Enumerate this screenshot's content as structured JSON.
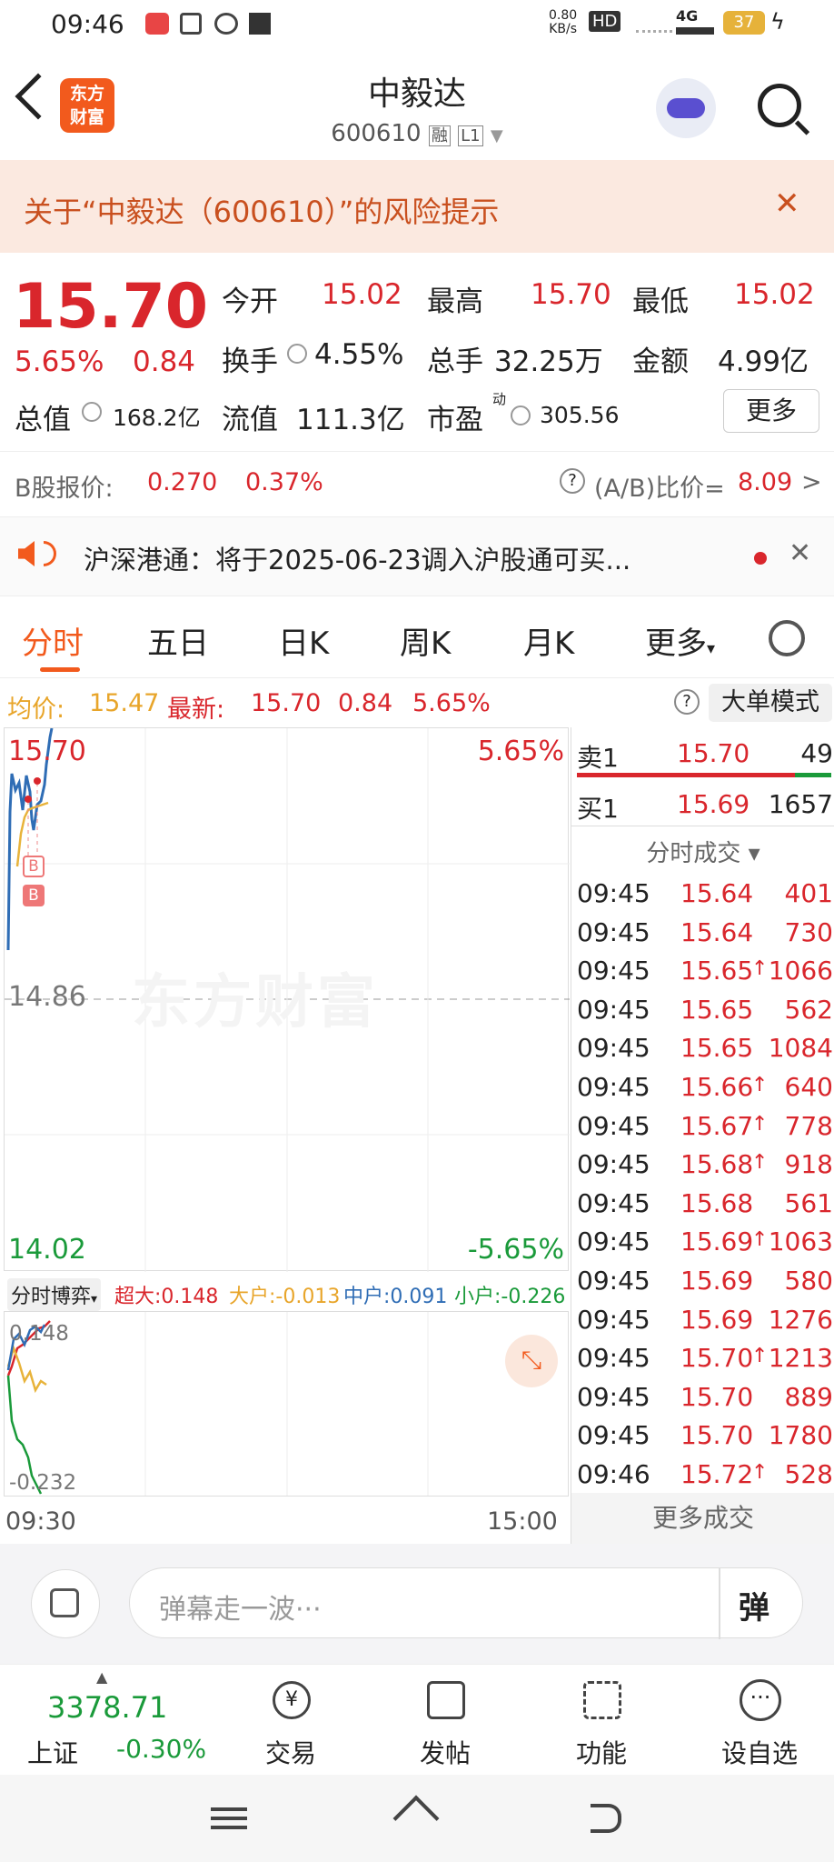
{
  "status": {
    "time": "09:46",
    "net_speed": "0.80",
    "net_unit": "KB/s",
    "hd": "HD",
    "signal": "4G",
    "battery": "37"
  },
  "header": {
    "logo_line1": "东方",
    "logo_line2": "财富",
    "title": "中毅达",
    "code": "600610",
    "badge_rong": "融",
    "badge_l1": "L1"
  },
  "risk": {
    "text": "关于“中毅达（600610）”的风险提示",
    "close": "✕"
  },
  "quote": {
    "price": "15.70",
    "change_pct": "5.65%",
    "change": "0.84",
    "open_label": "今开",
    "open": "15.02",
    "high_label": "最高",
    "high": "15.70",
    "low_label": "最低",
    "low": "15.02",
    "turnover_label": "换手",
    "turnover": "4.55%",
    "volume_label": "总手",
    "volume": "32.25万",
    "amount_label": "金额",
    "amount": "4.99亿",
    "mcap_label": "总值",
    "mcap": "168.2亿",
    "float_label": "流值",
    "float": "111.3亿",
    "pe_label": "市盈",
    "pe_sup": "动",
    "pe": "305.56",
    "more": "更多"
  },
  "bshare": {
    "label": "B股报价:",
    "price": "0.270",
    "pct": "0.37%",
    "ratio_label": "(A/B)比价=",
    "ratio": "8.09",
    "arrow": ">"
  },
  "notice": {
    "text": "沪深港通：将于2025-06-23调入沪股通可买...",
    "close": "✕"
  },
  "tabs": [
    {
      "label": "分时"
    },
    {
      "label": "五日"
    },
    {
      "label": "日K"
    },
    {
      "label": "周K"
    },
    {
      "label": "月K"
    },
    {
      "label": "更多"
    }
  ],
  "infobar": {
    "avg_label": "均价:",
    "avg": "15.47",
    "latest_label": "最新:",
    "latest": "15.70",
    "chg": "0.84",
    "pct": "5.65%",
    "mode": "大单模式"
  },
  "chart": {
    "top_price": "15.70",
    "top_pct": "5.65%",
    "mid_price": "14.86",
    "bottom_price": "14.02",
    "bottom_pct": "-5.65%",
    "watermark": "东方财富",
    "marker": "B"
  },
  "flow": {
    "selector": "分时博弈",
    "chaoda_label": "超大:",
    "chaoda": "0.148",
    "dahu_label": "大户:",
    "dahu": "-0.013",
    "zhonghu_label": "中户:",
    "zhonghu": "0.091",
    "xiaohu_label": "小户:",
    "xiaohu": "-0.226",
    "ymax": "0.148",
    "ymin": "-0.232"
  },
  "times": {
    "start": "09:30",
    "end": "15:00"
  },
  "orderbook": {
    "sell_label": "卖1",
    "sell_price": "15.70",
    "sell_vol": "49",
    "buy_label": "买1",
    "buy_price": "15.69",
    "buy_vol": "1657",
    "ticks_title": "分时成交 ▾",
    "more_trades": "更多成交"
  },
  "ticks": [
    {
      "t": "09:45",
      "p": "15.64",
      "a": "",
      "v": "401"
    },
    {
      "t": "09:45",
      "p": "15.64",
      "a": "",
      "v": "730"
    },
    {
      "t": "09:45",
      "p": "15.65",
      "a": "↑",
      "v": "1066"
    },
    {
      "t": "09:45",
      "p": "15.65",
      "a": "",
      "v": "562"
    },
    {
      "t": "09:45",
      "p": "15.65",
      "a": "",
      "v": "1084"
    },
    {
      "t": "09:45",
      "p": "15.66",
      "a": "↑",
      "v": "640"
    },
    {
      "t": "09:45",
      "p": "15.67",
      "a": "↑",
      "v": "778"
    },
    {
      "t": "09:45",
      "p": "15.68",
      "a": "↑",
      "v": "918"
    },
    {
      "t": "09:45",
      "p": "15.68",
      "a": "",
      "v": "561"
    },
    {
      "t": "09:45",
      "p": "15.69",
      "a": "↑",
      "v": "1063"
    },
    {
      "t": "09:45",
      "p": "15.69",
      "a": "",
      "v": "580"
    },
    {
      "t": "09:45",
      "p": "15.69",
      "a": "",
      "v": "1276"
    },
    {
      "t": "09:45",
      "p": "15.70",
      "a": "↑",
      "v": "1213"
    },
    {
      "t": "09:45",
      "p": "15.70",
      "a": "",
      "v": "889"
    },
    {
      "t": "09:45",
      "p": "15.70",
      "a": "",
      "v": "1780"
    },
    {
      "t": "09:46",
      "p": "15.72",
      "a": "↑",
      "v": "528"
    }
  ],
  "danmu": {
    "placeholder": "弹幕走一波···",
    "btn": "弹"
  },
  "bottomnav": {
    "index_value": "3378.71",
    "index_name": "上证",
    "index_pct": "-0.30%",
    "trade": "交易",
    "post": "发帖",
    "func": "功能",
    "watch": "设自选"
  },
  "colors": {
    "red": "#d9262c",
    "green": "#1a9a3a",
    "avg_line": "#e8b33a",
    "price_line": "#2f6db5",
    "accent": "#f25a1d"
  }
}
